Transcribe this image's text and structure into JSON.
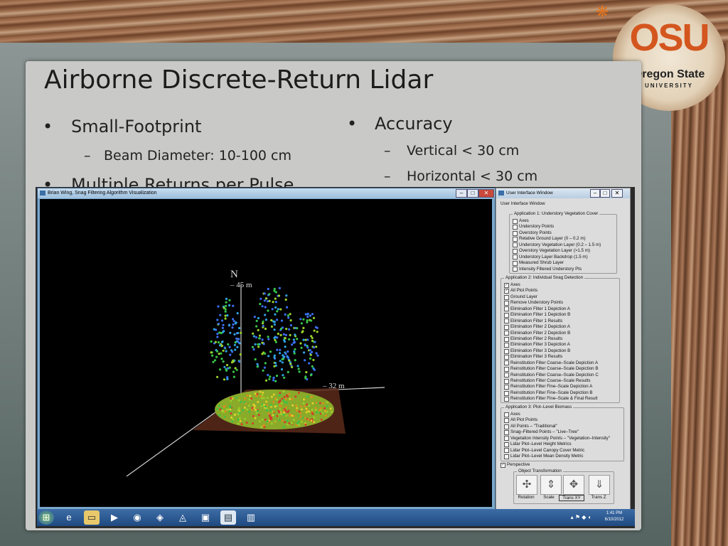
{
  "slide": {
    "title": "Airborne Discrete-Return Lidar",
    "left_bullets": [
      {
        "level": 1,
        "text": "Small-Footprint"
      },
      {
        "level": 2,
        "text": "Beam Diameter: 10-100 cm"
      },
      {
        "level": 1,
        "text": "Multiple Returns per Pulse"
      }
    ],
    "right_bullets": [
      {
        "level": 1,
        "text": "Accuracy"
      },
      {
        "level": 2,
        "text": "Vertical < 30 cm"
      },
      {
        "level": 2,
        "text": "Horizontal < 30 cm"
      }
    ],
    "bullet_l1": "•",
    "bullet_l2": "–"
  },
  "logo": {
    "letters": "OSU",
    "name": "Oregon State",
    "sub": "UNIVERSITY",
    "accent_color": "#d4561f"
  },
  "viz_window": {
    "title": "Brian Wing, Snag Filtering Algorithm Visualization",
    "labels": {
      "height": "45 m",
      "width": "32 m",
      "north": "N"
    }
  },
  "ui_window": {
    "title": "User Interface Window",
    "subtitle": "User Interface Window",
    "groups": [
      {
        "title": "Application 1: Understory Vegetation Cover",
        "items": [
          {
            "label": "Axes",
            "checked": false
          },
          {
            "label": "Understory Points",
            "checked": false
          },
          {
            "label": "Overstory Points",
            "checked": false
          },
          {
            "label": "Relative Ground Layer (0 – 0.2 m)",
            "checked": false
          },
          {
            "label": "Understory Vegetation Layer (0.2 – 1.5 m)",
            "checked": false
          },
          {
            "label": "Overstory Vegetation Layer (>1.5 m)",
            "checked": false
          },
          {
            "label": "Understory Layer Backdrop (1.5 m)",
            "checked": false
          },
          {
            "label": "Measured Shrub Layer",
            "checked": false
          },
          {
            "label": "Intensity Filtered Understory Pts",
            "checked": false
          }
        ]
      },
      {
        "title": "Application 2: Individual Snag Detection",
        "items": [
          {
            "label": "Axes",
            "checked": true
          },
          {
            "label": "All Plot Points",
            "checked": true
          },
          {
            "label": "Ground Layer",
            "checked": false
          },
          {
            "label": "Remove Understory Points",
            "checked": false
          },
          {
            "label": "Elimination Filter 1 Depiction A",
            "checked": false
          },
          {
            "label": "Elimination Filter 1 Depiction B",
            "checked": false
          },
          {
            "label": "Elimination Filter 1 Results",
            "checked": false
          },
          {
            "label": "Elimination Filter 2 Depiction A",
            "checked": false
          },
          {
            "label": "Elimination Filter 2 Depiction B",
            "checked": false
          },
          {
            "label": "Elimination Filter 2 Results",
            "checked": false
          },
          {
            "label": "Elimination Filter 3 Depiction A",
            "checked": false
          },
          {
            "label": "Elimination Filter 3 Depiction B",
            "checked": false
          },
          {
            "label": "Elimination Filter 3 Results",
            "checked": false
          },
          {
            "label": "Reinstitution Filter Coarse–Scale Depiction A",
            "checked": false
          },
          {
            "label": "Reinstitution Filter Coarse–Scale Depiction B",
            "checked": false
          },
          {
            "label": "Reinstitution Filter Coarse–Scale Depiction C",
            "checked": false
          },
          {
            "label": "Reinstitution Filter Coarse–Scale Results",
            "checked": false
          },
          {
            "label": "Reinstitution Filter Fine–Scale Depiction A",
            "checked": false
          },
          {
            "label": "Reinstitution Filter Fine–Scale Depiction B",
            "checked": false
          },
          {
            "label": "Reinstitution Filter Fine–Scale & Final Result",
            "checked": false
          }
        ]
      },
      {
        "title": "Application 3: Plot–Level Biomass",
        "items": [
          {
            "label": "Axes",
            "checked": false
          },
          {
            "label": "All Plot Points",
            "checked": false
          },
          {
            "label": "All Points – \"Traditional\"",
            "checked": false
          },
          {
            "label": "Snag–Filtered Points – \"Live–Tree\"",
            "checked": false
          },
          {
            "label": "Vegetation Intensity Points – \"Vegetation–Intensity\"",
            "checked": false
          },
          {
            "label": "Lidar Plot–Level Height Metrics",
            "checked": false
          },
          {
            "label": "Lidar Plot–Level Canopy Cover Metric",
            "checked": false
          },
          {
            "label": "Lidar Plot–Level Mean Density Metric",
            "checked": false
          }
        ]
      }
    ],
    "perspective_label": "Perspective",
    "perspective_checked": true,
    "object_transformation": "Object Transformation",
    "tools": [
      {
        "label": "Rotation",
        "icon": "rotation-icon"
      },
      {
        "label": "Scale",
        "icon": "scale-icon"
      },
      {
        "label": "Trans XY",
        "icon": "translate-xy-icon"
      },
      {
        "label": "Trans Z",
        "icon": "translate-z-icon"
      }
    ]
  },
  "taskbar": {
    "time": "1:41 PM",
    "date": "6/10/2012"
  }
}
